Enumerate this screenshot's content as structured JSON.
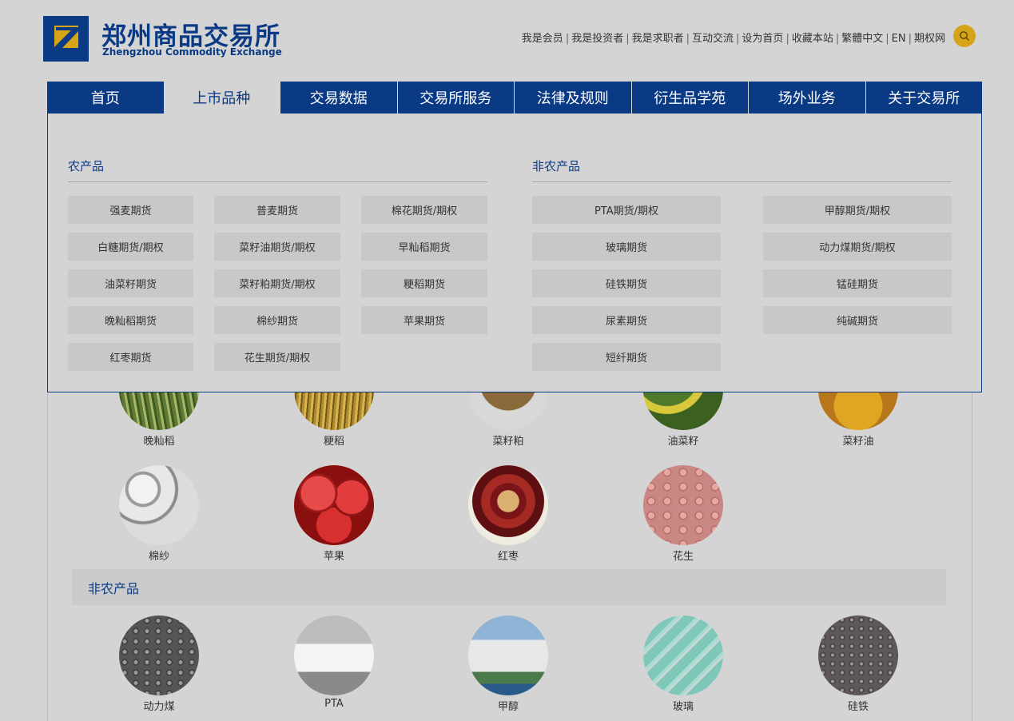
{
  "logo": {
    "cn": "郑州商品交易所",
    "en": "Zhengzhou Commodity Exchange"
  },
  "toplinks": [
    "我是会员",
    "我是投资者",
    "我是求职者",
    "互动交流",
    "设为首页",
    "收藏本站",
    "繁體中文",
    "EN",
    "期权网"
  ],
  "nav": [
    "首页",
    "上市品种",
    "交易数据",
    "交易所服务",
    "法律及规则",
    "衍生品学苑",
    "场外业务",
    "关于交易所"
  ],
  "dropdown": {
    "agri_title": "农产品",
    "agri": [
      "强麦期货",
      "普麦期货",
      "棉花期货/期权",
      "白糖期货/期权",
      "菜籽油期货/期权",
      "早籼稻期货",
      "油菜籽期货",
      "菜籽粕期货/期权",
      "粳稻期货",
      "晚籼稻期货",
      "棉纱期货",
      "苹果期货",
      "红枣期货",
      "花生期货/期权"
    ],
    "nonagri_title": "非农产品",
    "nonagri": [
      "PTA期货/期权",
      "甲醇期货/期权",
      "玻璃期货",
      "动力煤期货/期权",
      "硅铁期货",
      "锰硅期货",
      "尿素期货",
      "纯碱期货",
      "短纤期货"
    ]
  },
  "products_row1": [
    "晚籼稻",
    "粳稻",
    "菜籽粕",
    "油菜籽",
    "菜籽油"
  ],
  "products_row2": [
    "棉纱",
    "苹果",
    "红枣",
    "花生"
  ],
  "section_nonagri": "非农产品",
  "products_row3": [
    "动力煤",
    "PTA",
    "甲醇",
    "玻璃",
    "硅铁"
  ],
  "colors": {
    "brand": "#0b3a84",
    "search": "#d5a419",
    "background": "#d4d4d4"
  }
}
